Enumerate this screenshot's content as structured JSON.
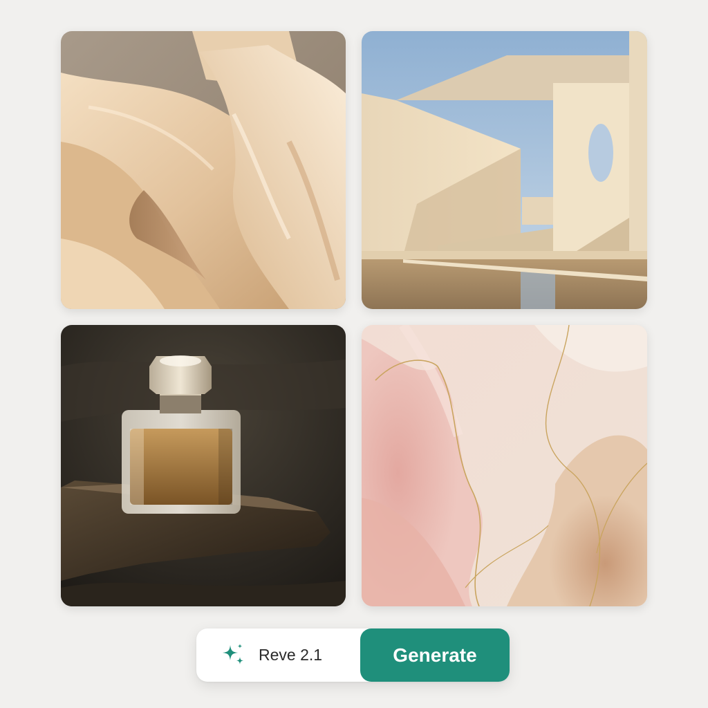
{
  "gallery": {
    "tiles": [
      {
        "subject": "flowing cream silk dress"
      },
      {
        "subject": "minimalist beige architecture with reflecting pool"
      },
      {
        "subject": "perfume bottle on wet dark rock"
      },
      {
        "subject": "pink and beige marble with gold veins"
      }
    ]
  },
  "toolbar": {
    "model_icon": "sparkle-icon",
    "model_label": "Reve 2.1",
    "generate_label": "Generate",
    "accent_color": "#1f8f7b"
  }
}
